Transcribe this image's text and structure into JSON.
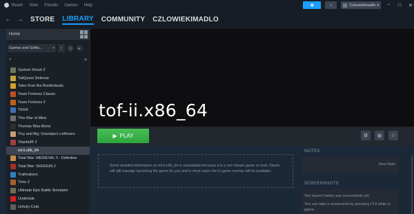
{
  "menubar": {
    "app_name": "Steam",
    "items": [
      "View",
      "Friends",
      "Games",
      "Help"
    ],
    "username": "Czlowiekimadlo",
    "minimize": "−",
    "maximize": "□",
    "close": "✕",
    "broadcast_icon": "broadcast-icon",
    "bell_icon": "bell-icon"
  },
  "nav": {
    "back": "←",
    "forward": "→",
    "store": "STORE",
    "library": "LIBRARY",
    "community": "COMMUNITY",
    "profile": "CZLOWIEKIMADLO",
    "accent_color": "#1a9fff"
  },
  "sidebar": {
    "home": "Home",
    "filter_label": "Games and Softw...",
    "games": [
      {
        "name": "System Shock 2",
        "color": "#6a7a5a"
      },
      {
        "name": "TailQuest Defense",
        "color": "#c8a040"
      },
      {
        "name": "Tales from the Borderlands",
        "color": "#d0a030"
      },
      {
        "name": "Team Fortress Classic",
        "color": "#c05020"
      },
      {
        "name": "Team Fortress 2",
        "color": "#c06020"
      },
      {
        "name": "TERA",
        "color": "#4070b0"
      },
      {
        "name": "This War of Mine",
        "color": "#707070"
      },
      {
        "name": "Thomas Was Alone",
        "color": "#303030"
      },
      {
        "name": "Tiny and Big: Grandpa's Leftovers",
        "color": "#c0a070"
      },
      {
        "name": "Titanfall® 2",
        "color": "#a04040"
      },
      {
        "name": "tof-ii.x86_64",
        "color": "#3d4450"
      },
      {
        "name": "Total War: MEDIEVAL II - Definitive",
        "color": "#c09050"
      },
      {
        "name": "Total War: SHOGUN 2",
        "color": "#a03030"
      },
      {
        "name": "Trailmakers",
        "color": "#3080c0"
      },
      {
        "name": "Trine 2",
        "color": "#a06030"
      },
      {
        "name": "Ultimate Epic Battle Simulator",
        "color": "#707050"
      },
      {
        "name": "Undertale",
        "color": "#d02020"
      },
      {
        "name": "Unholy Cold",
        "color": "#606060"
      }
    ],
    "selected_index": 10
  },
  "main": {
    "game_title": "tof-ii.x86_64",
    "play_label": "PLAY",
    "play_icon": "▶",
    "play_color": "#3ab54a",
    "info_text": "Some detailed information on tof-ii.x86_64 is unavailable because it is a non-Steam game or mod. Steam will still manage launching the game for you and in most cases the in-game overlay will be available.",
    "notes_title": "NOTES",
    "new_note": "New Note",
    "screenshots_title": "SCREENSHOTS",
    "screenshots_line1": "You haven't taken any screenshots yet",
    "screenshots_line2": "You can take a screenshot by pressing F12 while in game."
  }
}
